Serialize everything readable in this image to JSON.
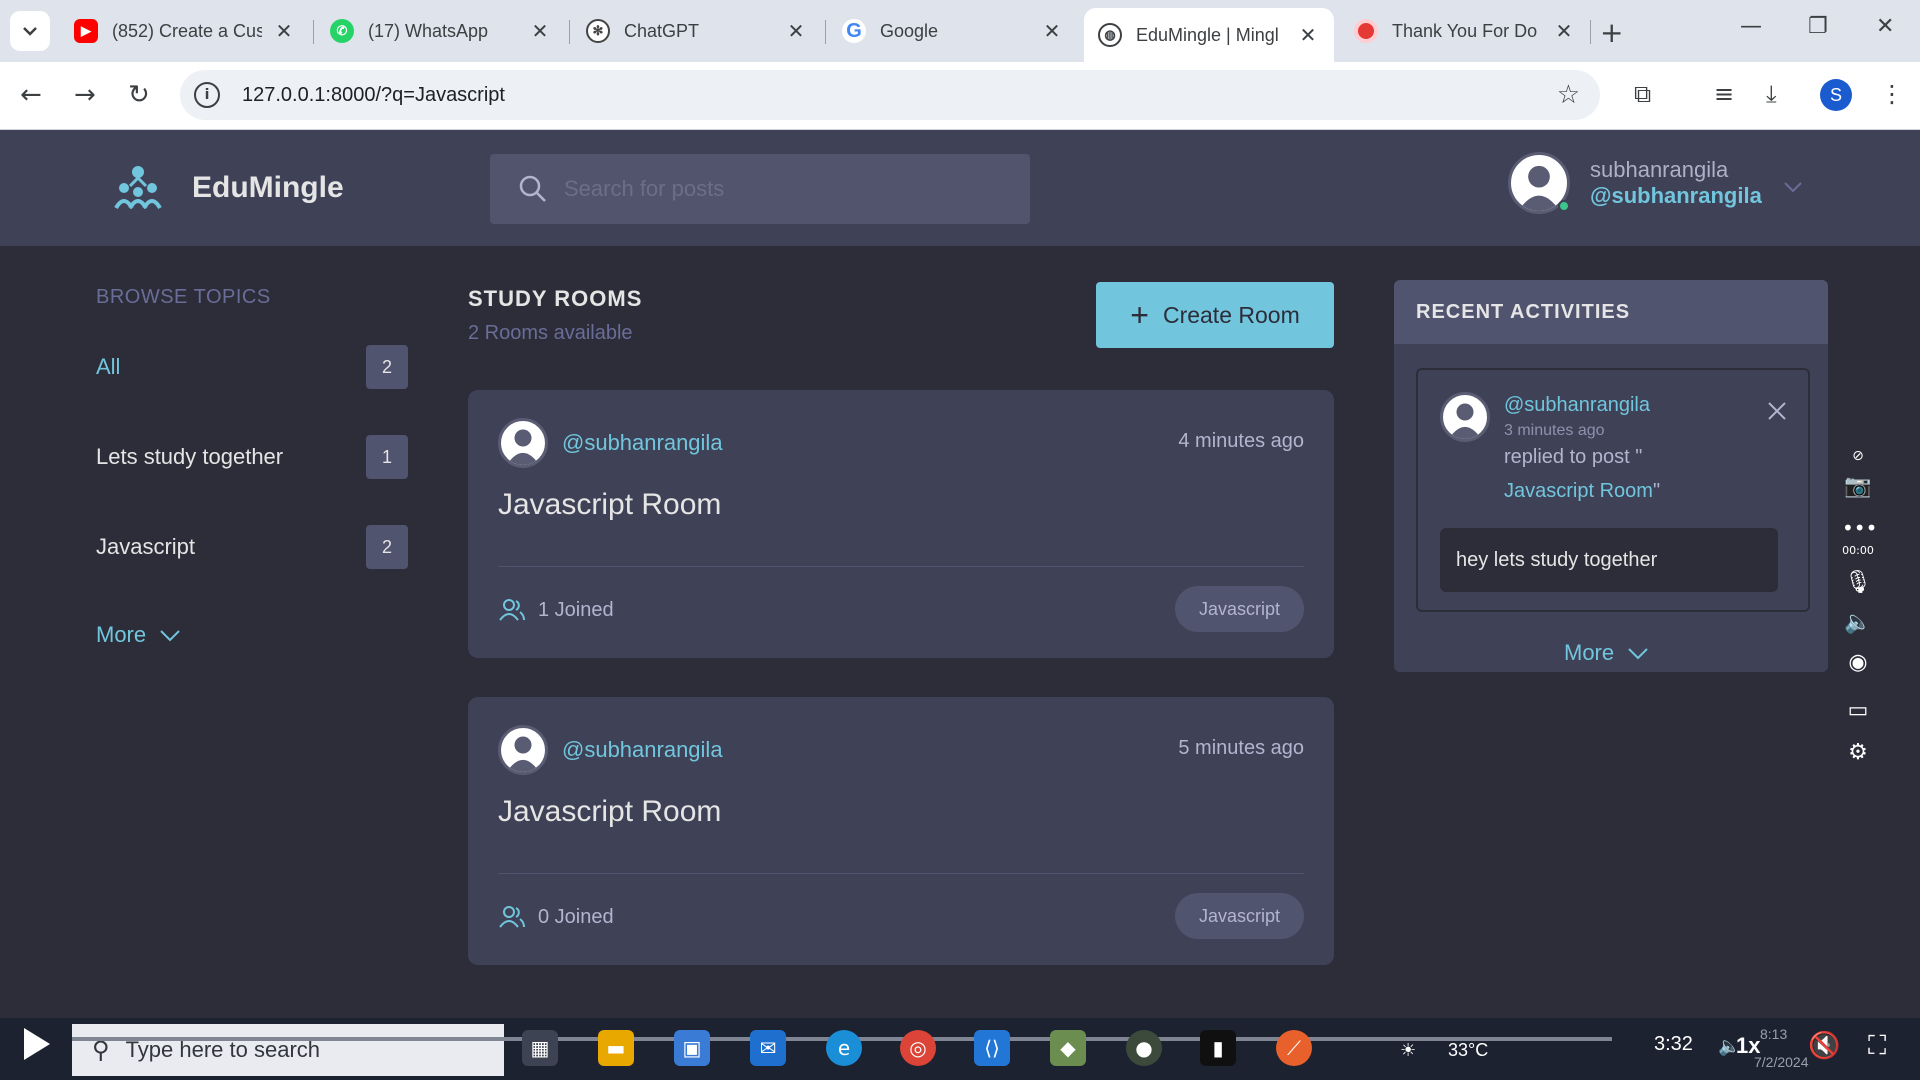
{
  "browser": {
    "tabs": [
      {
        "title": "(852) Create a Cus",
        "icon": "youtube-icon",
        "color": "#ff0000"
      },
      {
        "title": "(17) WhatsApp",
        "icon": "whatsapp-icon",
        "color": "#25d366"
      },
      {
        "title": "ChatGPT",
        "icon": "chatgpt-icon",
        "color": "#444444"
      },
      {
        "title": "Google",
        "icon": "google-icon",
        "color": "#4285f4"
      },
      {
        "title": "EduMingle | Mingl",
        "icon": "globe-icon",
        "color": "#3c4043"
      },
      {
        "title": "Thank You For Do",
        "icon": "record-icon",
        "color": "#e53935"
      }
    ],
    "url": "127.0.0.1:8000/?q=Javascript",
    "profile_initial": "S"
  },
  "app": {
    "name": "EduMingle",
    "search_placeholder": "Search for posts",
    "user": {
      "name": "subhanrangila",
      "handle": "@subhanrangila"
    }
  },
  "sidebar": {
    "title": "BROWSE TOPICS",
    "topics": [
      {
        "label": "All",
        "count": "2"
      },
      {
        "label": "Lets study together",
        "count": "1"
      },
      {
        "label": "Javascript",
        "count": "2"
      }
    ],
    "more_label": "More"
  },
  "rooms": {
    "title": "STUDY ROOMS",
    "subtitle": "2 Rooms available",
    "create_label": "Create Room",
    "items": [
      {
        "host": "@subhanrangila",
        "time": "4 minutes ago",
        "title": "Javascript Room",
        "joined": "1 Joined",
        "topic": "Javascript"
      },
      {
        "host": "@subhanrangila",
        "time": "5 minutes ago",
        "title": "Javascript Room",
        "joined": "0 Joined",
        "topic": "Javascript"
      }
    ]
  },
  "activities": {
    "title": "RECENT ACTIVITIES",
    "item": {
      "handle": "@subhanrangila",
      "time": "3 minutes ago",
      "action": "replied to post \"",
      "room": "Javascript Room",
      "room_suffix": "\"",
      "message": "hey lets study together"
    },
    "more_label": "More"
  },
  "recorder": {
    "timer": "00:00"
  },
  "taskbar": {
    "search_placeholder": "Type here to search",
    "temperature": "33°C",
    "video_time": "3:32",
    "speed": "1x",
    "clock": "8:13",
    "date": "7/2/2024",
    "video_progress": 0.0
  },
  "colors": {
    "accent": "#71c6dd",
    "bg_dark": "#2d2d39",
    "bg_card": "#3f4156",
    "bg_soft": "#51546e",
    "muted": "#696d97"
  }
}
